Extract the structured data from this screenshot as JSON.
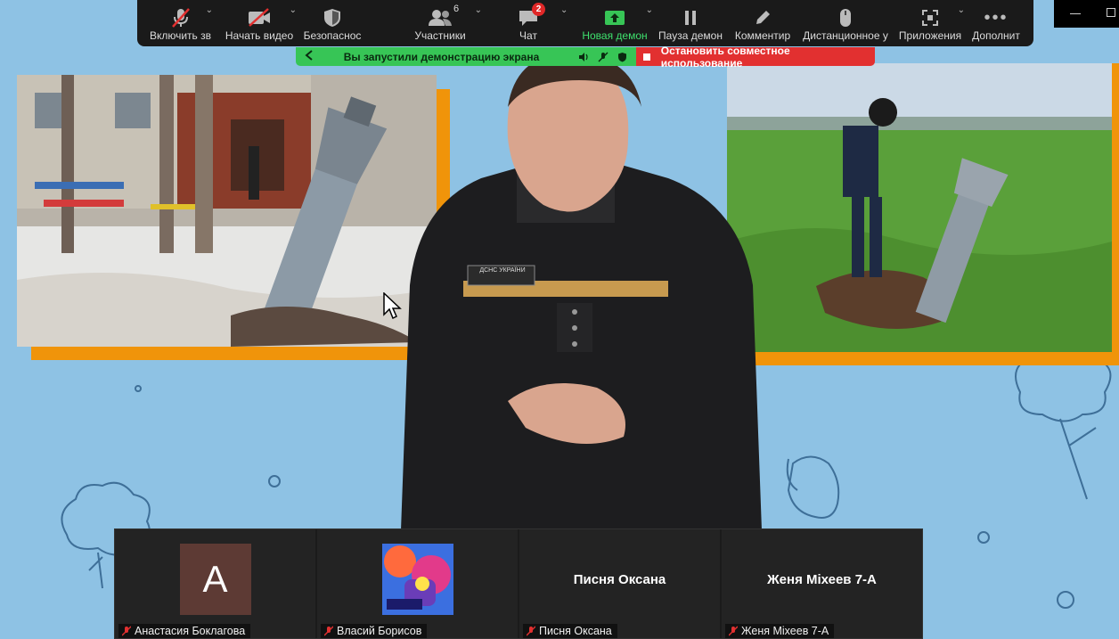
{
  "toolbar": {
    "items": [
      {
        "label": "Включить зв",
        "icon": "muted-mic-icon"
      },
      {
        "label": "Начать видео",
        "icon": "video-off-icon"
      },
      {
        "label": "Безопаснос",
        "icon": "shield-icon"
      },
      {
        "label": "Участники",
        "icon": "participants-icon",
        "count": "6"
      },
      {
        "label": "Чат",
        "icon": "chat-icon",
        "badge": "2"
      },
      {
        "label": "Новая демон",
        "icon": "share-screen-icon"
      },
      {
        "label": "Пауза демон",
        "icon": "pause-icon"
      },
      {
        "label": "Комментир",
        "icon": "pen-icon"
      },
      {
        "label": "Дистанционное у",
        "icon": "mouse-icon"
      },
      {
        "label": "Приложения",
        "icon": "apps-icon"
      },
      {
        "label": "Дополнит",
        "icon": "more-icon"
      }
    ]
  },
  "share_banner": {
    "message": "Вы запустили демонстрацию экрана",
    "stop_label": "Остановить совместное использование"
  },
  "participants": [
    {
      "name": "Анастасия Боклагова",
      "avatar_letter": "A",
      "avatar_color": "#5d3a34"
    },
    {
      "name": "Власий Борисов",
      "avatar": "game-avatar-image"
    },
    {
      "name": "Писня Оксана",
      "display_name": "Писня Оксана"
    },
    {
      "name": "Женя Міхеев 7-А",
      "display_name": "Женя Міхеев 7-А"
    }
  ],
  "video": {
    "presenter_patch_text": "ДСНС УКРАЇНИ"
  },
  "colors": {
    "toolbar_bg": "#1a1a1a",
    "share_green": "#37c556",
    "share_red": "#e23030",
    "accent_orange": "#f0940a",
    "background_blue": "#8ec2e4"
  }
}
